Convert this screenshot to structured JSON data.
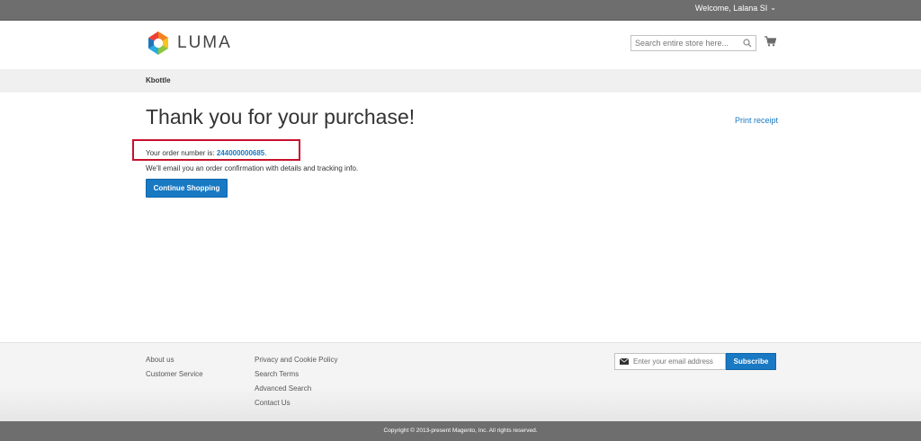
{
  "header": {
    "welcome_text": "Welcome, Lalana SI",
    "logo_text": "LUMA",
    "search_placeholder": "Search entire store here..."
  },
  "breadcrumb": {
    "current": "Kbottle"
  },
  "main": {
    "title": "Thank you for your purchase!",
    "print_receipt": "Print receipt",
    "order_prefix": "Your order number is: ",
    "order_number": "244000000685",
    "order_suffix": ".",
    "email_note": "We'll email you an order confirmation with details and tracking info.",
    "continue_label": "Continue Shopping"
  },
  "footer": {
    "col1": [
      "About us",
      "Customer Service"
    ],
    "col2": [
      "Privacy and Cookie Policy",
      "Search Terms",
      "Advanced Search",
      "Contact Us"
    ],
    "newsletter_placeholder": "Enter your email address",
    "subscribe_label": "Subscribe",
    "copyright": "Copyright © 2013-present Magento, Inc. All rights reserved."
  },
  "colors": {
    "accent": "#1979c3",
    "header_bar": "#6e6e6e",
    "highlight": "#c8102e"
  },
  "icons": {
    "logo": "luma-logo-icon",
    "search": "search-icon",
    "cart": "cart-icon",
    "caret": "chevron-down-icon",
    "mail": "mail-icon"
  }
}
